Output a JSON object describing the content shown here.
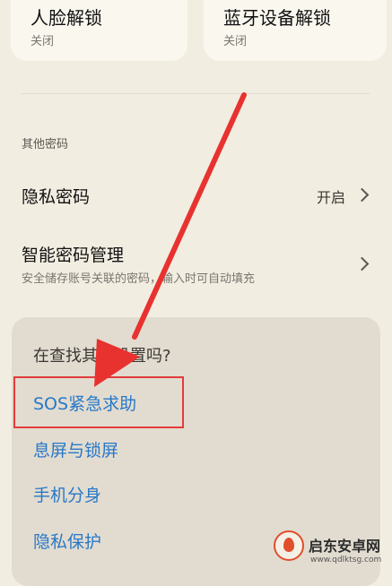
{
  "cards": [
    {
      "title": "人脸解锁",
      "status": "关闭"
    },
    {
      "title": "蓝牙设备解锁",
      "status": "关闭"
    }
  ],
  "section_label": "其他密码",
  "rows": {
    "privacy_password": {
      "title": "隐私密码",
      "value": "开启"
    },
    "smart_password": {
      "title": "智能密码管理",
      "subtitle": "安全储存账号关联的密码，输入时可自动填充"
    }
  },
  "suggest_panel": {
    "title": "在查找其他设置吗?",
    "links": [
      "SOS紧急求助",
      "息屏与锁屏",
      "手机分身",
      "隐私保护"
    ]
  },
  "annotation": {
    "highlight_color": "#e23b3b",
    "arrow_color": "#e8322f"
  },
  "watermark": {
    "text": "启东安卓网",
    "url": "www.qdlktsg.com"
  }
}
